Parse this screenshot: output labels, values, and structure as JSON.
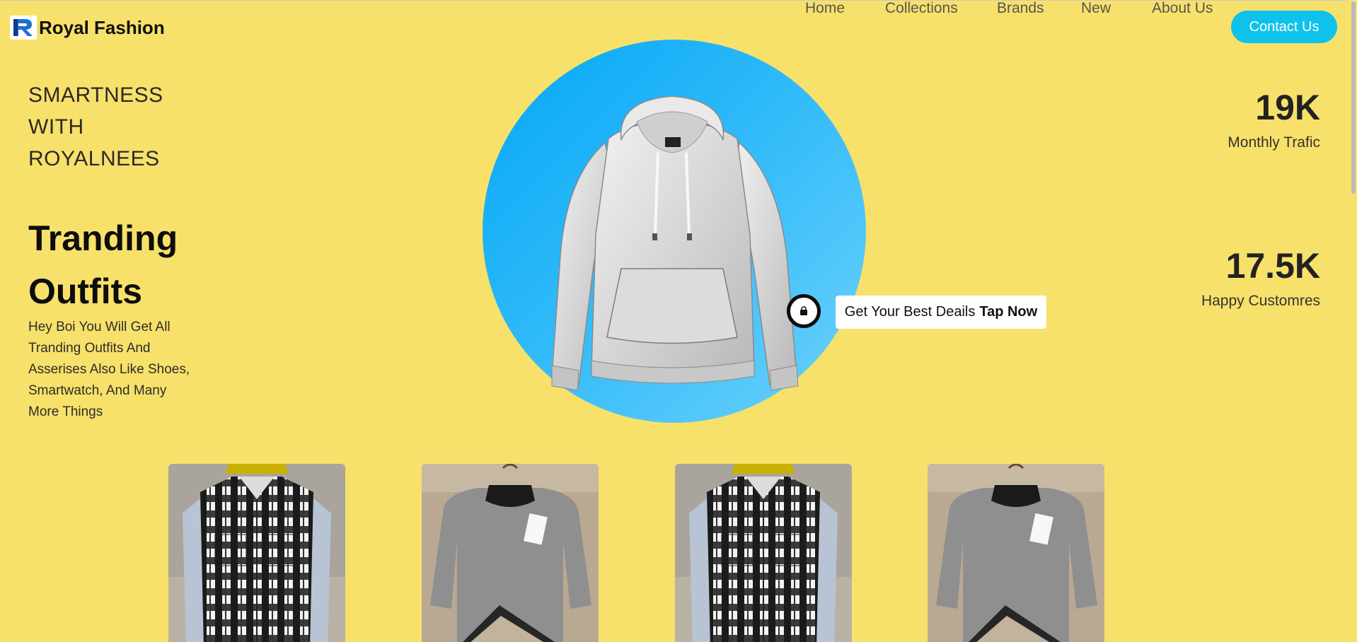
{
  "brand": {
    "name": "Royal Fashion"
  },
  "nav": {
    "links": [
      "Home",
      "Collections",
      "Brands",
      "New",
      "About Us"
    ],
    "contact_label": "Contact Us"
  },
  "hero": {
    "tagline": [
      "SMARTNESS",
      "WITH",
      "ROYALNEES"
    ],
    "heading": [
      "Tranding",
      "Outfits"
    ],
    "description": "Hey Boi You Will Get All Tranding Outfits And Asserises Also Like Shoes, Smartwatch, And Many More Things",
    "deal_text": "Get Your Best Deails",
    "deal_cta": "Tap Now"
  },
  "stats": [
    {
      "value": "19K",
      "label": "Monthly Trafic"
    },
    {
      "value": "17.5K",
      "label": "Happy Customres"
    }
  ],
  "products": [
    {
      "icon": "checked-shirt-image"
    },
    {
      "icon": "grey-sweater-image"
    },
    {
      "icon": "checked-shirt-image"
    },
    {
      "icon": "grey-sweater-image"
    }
  ],
  "colors": {
    "background": "#f8e16a",
    "accent": "#0ec2ec",
    "circle": "#0aaaf6"
  }
}
